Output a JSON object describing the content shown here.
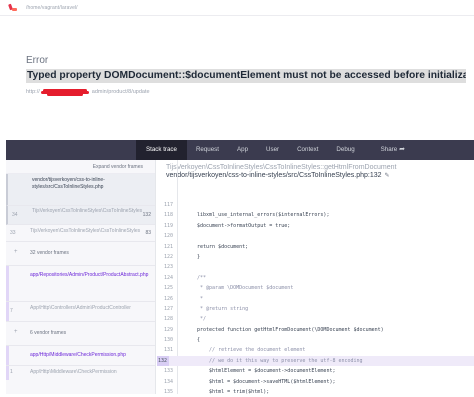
{
  "topbar": {
    "path": "/home/vagrant/laravel/"
  },
  "error": {
    "label": "Error",
    "message": "Typed property DOMDocument::$documentElement must not be accessed before initialization",
    "url_prefix": "http://",
    "url_suffix": "admin/product/8/update"
  },
  "tabs": {
    "stack_trace": "Stack trace",
    "request": "Request",
    "app": "App",
    "user": "User",
    "context": "Context",
    "debug": "Debug",
    "share": "Share"
  },
  "stack": {
    "expand_label": "Expand vendor frames",
    "frames": [
      {
        "name": "vendor/tijsverkoyen/css-to-inline-styles/src/CssToInlineStyles.php",
        "line": ""
      },
      {
        "number": "34",
        "class": "TijsVerkoyen\\CssToInlineStyles\\CssToInlineStyles",
        "line": "132"
      },
      {
        "number": "33",
        "class": "TijsVerkoyen\\CssToInlineStyles\\CssToInlineStyles",
        "line": "83"
      },
      {
        "number": "32",
        "group": "32 vendor frames"
      },
      {
        "name": "app/Repositories/Admin/Product/ProductAbstract.php",
        "line": ""
      },
      {
        "number": "7",
        "class": "App\\Http\\Controllers\\Admin\\ProductController",
        "line": ""
      },
      {
        "number": "6",
        "group": "6 vendor frames"
      },
      {
        "name": "app/Http/Middleware/CheckPermission.php",
        "line": ""
      },
      {
        "number": "1",
        "class": "App\\Http\\Middleware\\CheckPermission",
        "line": ""
      }
    ]
  },
  "code": {
    "class_title": "TijsVerkoyen\\CssToInlineStyles\\CssToInlineStyles::getHtmlFromDocument",
    "file": "vendor/tijsverkoyen/css-to-inline-styles/src/CssToInlineStyles.php:132",
    "lines": [
      {
        "n": "117",
        "text": ""
      },
      {
        "n": "118",
        "text": "libxml_use_internal_errors($internalErrors);"
      },
      {
        "n": "119",
        "text": "$document->formatOutput = true;"
      },
      {
        "n": "120",
        "text": ""
      },
      {
        "n": "121",
        "text": "return $document;"
      },
      {
        "n": "122",
        "text": "}"
      },
      {
        "n": "123",
        "text": ""
      },
      {
        "n": "124",
        "text": "/**"
      },
      {
        "n": "125",
        "text": " * @param \\DOMDocument $document"
      },
      {
        "n": "126",
        "text": " *"
      },
      {
        "n": "127",
        "text": " * @return string"
      },
      {
        "n": "128",
        "text": " */"
      },
      {
        "n": "129",
        "text": "protected function getHtmlFromDocument(\\DOMDocument $document)"
      },
      {
        "n": "130",
        "text": "{"
      },
      {
        "n": "131",
        "text": "    // retrieve the document element"
      },
      {
        "n": "132",
        "text": "    // we do it this way to preserve the utf-8 encoding"
      },
      {
        "n": "133",
        "text": "    $htmlElement = $document->documentElement;"
      },
      {
        "n": "134",
        "text": "    $html = $document->saveHTML($htmlElement);"
      },
      {
        "n": "135",
        "text": "    $html = trim($html);"
      }
    ],
    "highlighted_line": "132"
  },
  "colors": {
    "tabbar": "#3b3b4f",
    "tab_active": "#22222f",
    "highlight": "#efeaf9",
    "accent": "#7c3aed",
    "brand": "#e5334b"
  }
}
